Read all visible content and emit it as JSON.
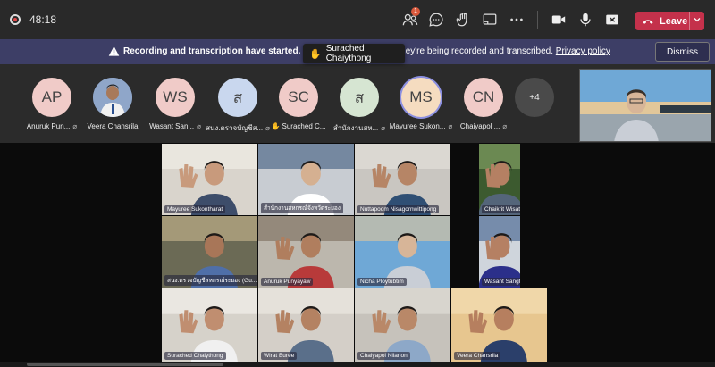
{
  "meeting": {
    "timer": "48:18",
    "people_badge": "1",
    "leave_label": "Leave"
  },
  "banner": {
    "bold_text": "Recording and transcription have started.",
    "text": "Let everyone know that they're being recorded and transcribed.",
    "link": "Privacy policy",
    "dismiss": "Dismiss"
  },
  "tooltip": {
    "name": "Surached Chaiythong"
  },
  "participants": [
    {
      "initials": "AP",
      "name": "Anuruk Pun...",
      "color": "#f0cbc8"
    },
    {
      "initials": "",
      "name": "Veera Chansrila",
      "color": "#8aa2c8"
    },
    {
      "initials": "WS",
      "name": "Wasant San...",
      "color": "#f0cbc8"
    },
    {
      "initials": "ส",
      "name": "สนง.ตรวจบัญชีส...",
      "color": "#c9d7ee"
    },
    {
      "initials": "SC",
      "name": "Surached C...",
      "color": "#f0cbc8"
    },
    {
      "initials": "ส",
      "name": "สำนักงานสห...",
      "color": "#d6e5d2"
    },
    {
      "initials": "MS",
      "name": "Mayuree Sukon...",
      "color": "#f5dcc0"
    },
    {
      "initials": "CN",
      "name": "Chaiyapol ...",
      "color": "#f0cbc8"
    }
  ],
  "more_count": "+4",
  "grid": [
    {
      "name": "Mayuree Sukontharat"
    },
    {
      "name": "สำนักงานสหกรณ์จังหวัดระยอง"
    },
    {
      "name": "Nuttapoom Nisagornwittipong"
    },
    {
      "name": "Chaikrit Wisattron"
    },
    {
      "name": "สนง.ตรวจบัญชีสหกรณ์ระยอง (Gu..."
    },
    {
      "name": "Anuruk Punyayaw"
    },
    {
      "name": "Nicha Ploytubtim"
    },
    {
      "name": "Wasant Sangthong"
    },
    {
      "name": "Surached Chaiythong"
    },
    {
      "name": "Wirat Buree"
    },
    {
      "name": "Chaiyapol Nilanon"
    },
    {
      "name": "Veera Chansrila"
    }
  ],
  "colors": {
    "topbar": "#292929",
    "banner": "#3d3e66",
    "leave": "#c4314b",
    "strip": "#2b2b2b",
    "raised_hand": "#f2b640"
  }
}
